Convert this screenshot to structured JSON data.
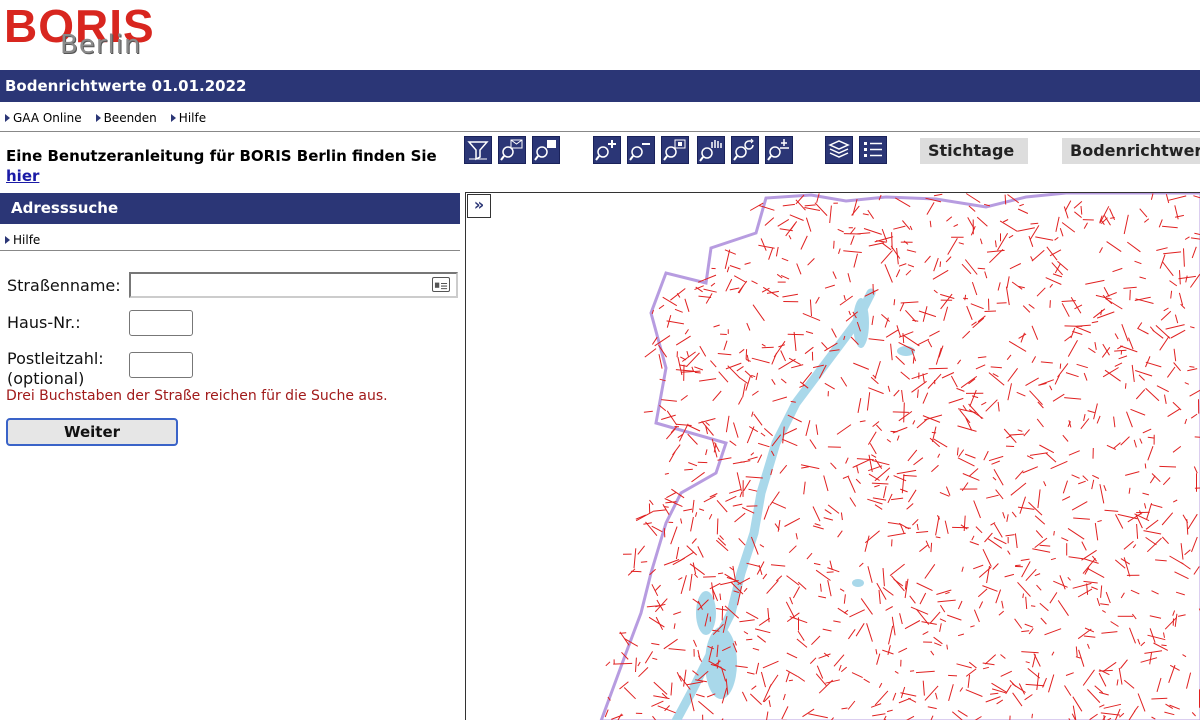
{
  "logo": {
    "line1": "BORIS",
    "line2": "Berlin"
  },
  "title": "Bodenrichtwerte 01.01.2022",
  "nav": [
    {
      "label": "GAA Online"
    },
    {
      "label": "Beenden"
    },
    {
      "label": "Hilfe"
    }
  ],
  "guide": {
    "text": "Eine Benutzeranleitung für BORIS Berlin finden Sie",
    "link": "hier"
  },
  "toolbar": {
    "icons": [
      "filter-icon",
      "zoom-mail-icon",
      "zoom-window-icon",
      "zoom-in-icon",
      "zoom-out-icon",
      "zoom-full-icon",
      "pan-icon",
      "zoom-back-icon",
      "zoom-next-icon",
      "layers-icon",
      "legend-icon"
    ],
    "stichtage": "Stichtage",
    "bodenrichtwerte": "Bodenrichtwer"
  },
  "side": {
    "header": "Adresssuche",
    "help": "Hilfe",
    "street_label": "Straßenname:",
    "house_label": "Haus-Nr.:",
    "zip_label_1": "Postleitzahl:",
    "zip_label_2": "(optional)",
    "hint": "Drei Buchstaben der Straße reichen für die Suche aus.",
    "submit": "Weiter"
  },
  "map": {
    "expand": "»"
  },
  "colors": {
    "brand": "#2b3676",
    "logo_red": "#d8261f",
    "map_lines": "#e02020",
    "boundary": "#b79ce0",
    "water": "#a9d8ea"
  }
}
